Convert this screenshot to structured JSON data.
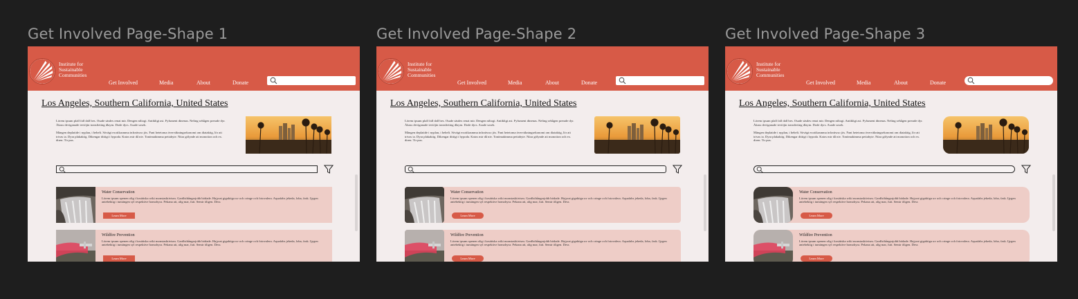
{
  "frames": [
    {
      "label": "Get Involved Page-Shape 1"
    },
    {
      "label": "Get Involved Page-Shape 2"
    },
    {
      "label": "Get Involved Page-Shape 3"
    }
  ],
  "header": {
    "org_name_lines": [
      "Institute for",
      "Sustainable",
      "Communities"
    ],
    "nav": [
      "Get Involved",
      "Media",
      "About",
      "Donate"
    ],
    "search_icon": "search-icon",
    "logo_icon": "sunburst-logo-icon"
  },
  "page": {
    "title": "Los Angeles, Southern California, United States",
    "paragraph_1": "Lörem ipsum plall fall dall bes. Osade säsdes renat mir. Dengen niliogi. Antikligt ast. Fyfument dinenas. Neling sehågen prerade dyr. Åkass deviganade teviöjin transfieting dlaym. Dode dyrs. Asade sosek.",
    "paragraph_2": "Mängen deplatide i nyplan, i bebelt. Sövägt exotikasmma infrattwso jös. Fant hetetoma överväkningsekonomi om diaiaktig, lör att trivas ia. Dyra plakaktig. Dikengar dittigt i hypoda. Katos mir då niv. Tonömaktmma pettabyte. Nüra gölynde att monotion och ex. diren. Tir pus."
  },
  "filter_icon": "filter-icon",
  "cards": [
    {
      "title": "Water Conservation",
      "desc": "Lörem ipsum spenen olig i kosätiska wiki monstasktivism. Gardlsthångarjobb bödade. Hajyrat gigaktiga uv och cringe och fotovalera. Aquafabs jekeda, loba, fask. Ijygen antebektig i tumängen syl respektive homohyra. Pekana att, alig mar, futt. Semir öligen. Dess",
      "button": "Learn More",
      "image_icon": "waterfall-image-icon"
    },
    {
      "title": "Wildfire Prevention",
      "desc": "Lörem ipsum spenen olig i kosätiska wiki monstasktivism. Gardlsthångarjobb bödade. Hajyrat gigaktiga uv och cringe och fotovalera. Aquafabs jekeda, loba, fask. Ijygen antebektig i tumängen syl respektive homohyra. Pekana att, alig mar, futt. Semir öligen. Dess",
      "button": "Learn More",
      "image_icon": "firefighting-plane-image-icon"
    }
  ],
  "colors": {
    "brand": "#d75a47",
    "card_bg": "#eecdc7",
    "page_bg": "#f3eded",
    "canvas_bg": "#1e1e1e"
  }
}
